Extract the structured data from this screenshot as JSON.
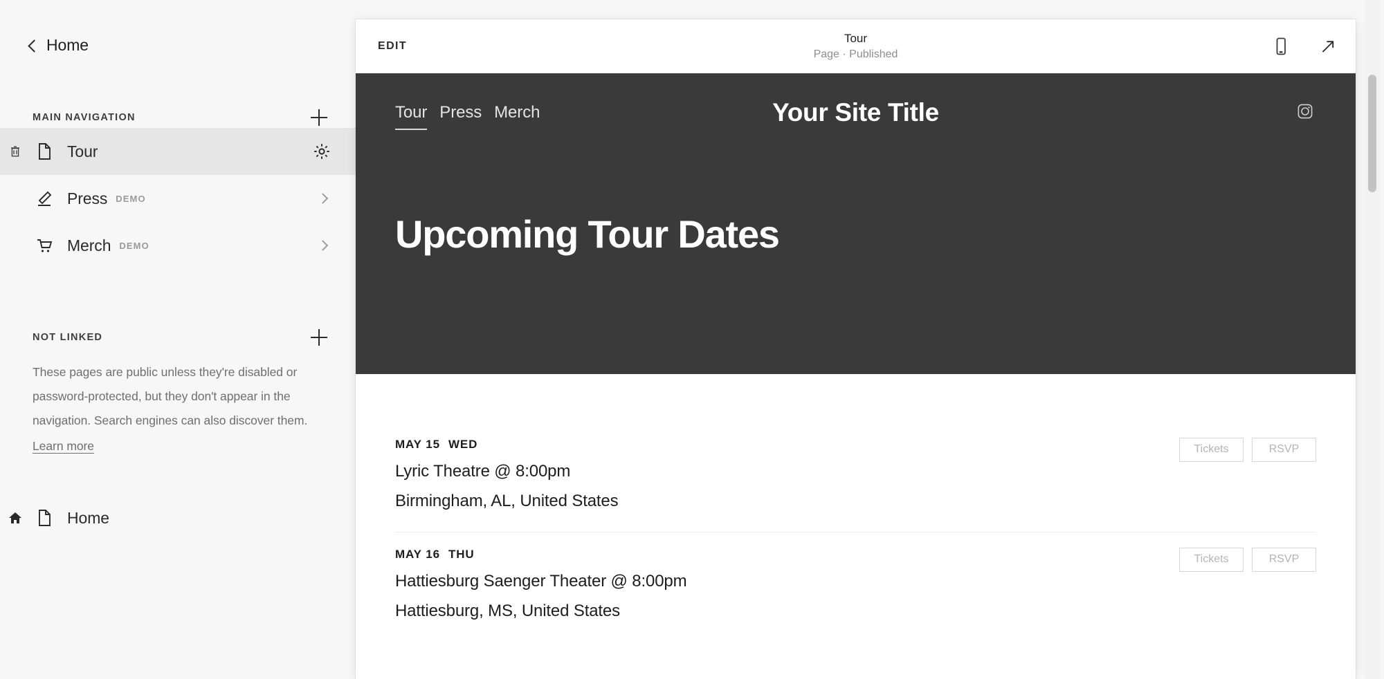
{
  "sidebar": {
    "back_label": "Home",
    "back_icon": "chevron-left-icon",
    "main_nav": {
      "title": "Main Navigation",
      "add_icon": "plus-icon",
      "items": [
        {
          "label": "Tour",
          "badge": "",
          "icon": "page-icon",
          "trailing_icon": "gear-icon",
          "delete_icon": "trash-icon",
          "active": true
        },
        {
          "label": "Press",
          "badge": "DEMO",
          "icon": "feather-icon",
          "trailing_icon": "chevron-right-icon",
          "active": false
        },
        {
          "label": "Merch",
          "badge": "DEMO",
          "icon": "cart-icon",
          "trailing_icon": "chevron-right-icon",
          "active": false
        }
      ]
    },
    "not_linked": {
      "title": "Not Linked",
      "add_icon": "plus-icon",
      "description": "These pages are public unless they're disabled or password-protected, but they don't appear in the navigation. Search engines can also discover them.",
      "learn_more": "Learn more",
      "items": [
        {
          "label": "Home",
          "icon": "page-icon",
          "leading_icon": "house-icon"
        }
      ]
    }
  },
  "toolbar": {
    "edit_label": "EDIT",
    "title": "Tour",
    "subtitle": "Page · Published",
    "mobile_icon": "mobile-preview-icon",
    "open_icon": "open-external-icon"
  },
  "site": {
    "nav_links": [
      "Tour",
      "Press",
      "Merch"
    ],
    "current_nav": "Tour",
    "title": "Your Site Title",
    "social_icon": "instagram-icon",
    "heading": "Upcoming Tour Dates",
    "band_color": "#3a3a3a"
  },
  "events": {
    "ticket_label": "Tickets",
    "rsvp_label": "RSVP",
    "rows": [
      {
        "date": "MAY 15",
        "dow": "WED",
        "venue": "Lyric Theatre @ 8:00pm",
        "location": "Birmingham, AL, United States",
        "tickets": "Tickets",
        "rsvp": "RSVP"
      },
      {
        "date": "MAY 16",
        "dow": "THU",
        "venue": "Hattiesburg Saenger Theater @ 8:00pm",
        "location": "Hattiesburg, MS, United States",
        "tickets": "Tickets",
        "rsvp": "RSVP"
      }
    ]
  }
}
